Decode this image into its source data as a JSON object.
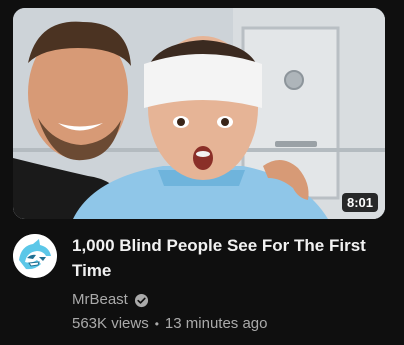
{
  "video": {
    "title": "1,000 Blind People See For The First Time",
    "duration": "8:01",
    "channel": "MrBeast",
    "views": "563K views",
    "separator": "•",
    "age": "13 minutes ago"
  },
  "icons": {
    "verified": "verified-check-icon",
    "avatar": "mrbeast-panther-logo"
  },
  "colors": {
    "background": "#0f0f0f",
    "title": "#f1f1f1",
    "meta": "#aaaaaa",
    "avatar_blue": "#5bc7e8"
  }
}
